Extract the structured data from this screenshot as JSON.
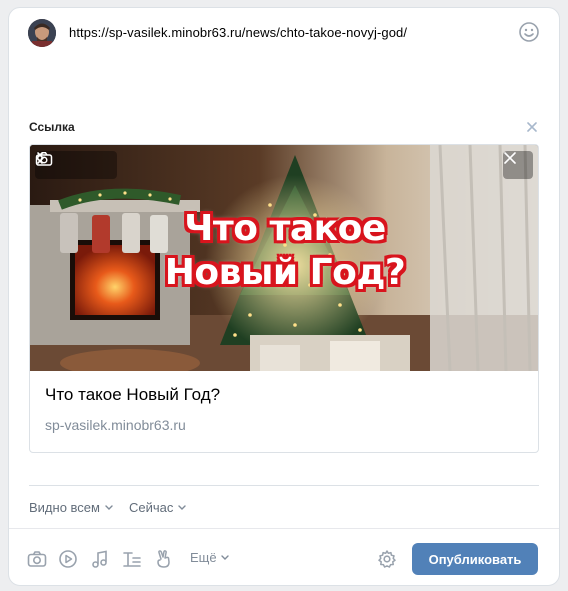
{
  "post": {
    "text": "https://sp-vasilek.minobr63.ru/news/chto-takoe-novyj-god/"
  },
  "attachment": {
    "section_label": "Ссылка",
    "image_overlay_line1": "Что такое",
    "image_overlay_line2": "Новый Год?",
    "title": "Что такое Новый Год?",
    "domain": "sp-vasilek.minobr63.ru"
  },
  "options": {
    "visibility": "Видно всем",
    "time": "Сейчас"
  },
  "toolbar": {
    "more_label": "Ещё",
    "publish_label": "Опубликовать"
  },
  "icons": {
    "emoji": "smile-icon",
    "remove": "close-icon",
    "prev": "chevron-left-icon",
    "next": "chevron-right-icon",
    "camera": "camera-icon",
    "photo": "camera-icon",
    "video": "play-circle-icon",
    "music": "music-note-icon",
    "article": "text-icon",
    "graffiti": "hand-icon",
    "settings": "gear-icon"
  },
  "colors": {
    "accent": "#5181b8",
    "muted": "#818c99",
    "overlay_stroke": "#d8141d"
  }
}
